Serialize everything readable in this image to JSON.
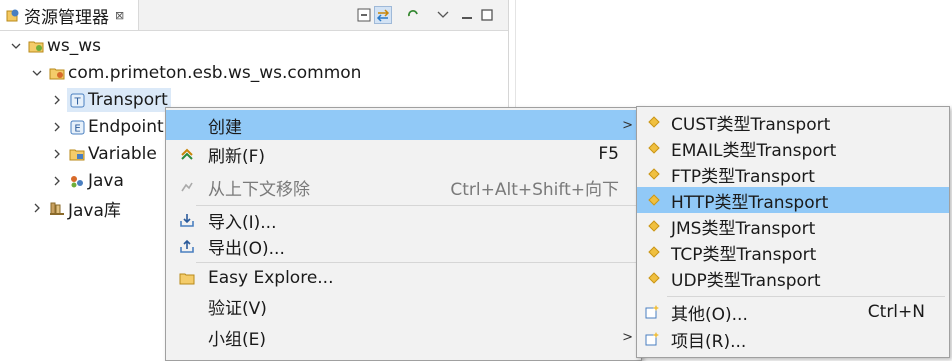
{
  "view": {
    "tab_title": "资源管理器",
    "tab_close": "⊠",
    "toolbar": [
      "collapse-all-icon",
      "link-with-editor-icon",
      "sync-icon",
      "view-menu-icon",
      "minimize-icon",
      "maximize-icon"
    ]
  },
  "tree": {
    "root": "ws_ws",
    "package": "com.primeton.esb.ws_ws.common",
    "children": [
      "Transport",
      "Endpoint",
      "Variable",
      "Java"
    ],
    "library": "Java库"
  },
  "context_menu": {
    "items": [
      {
        "label": "创建",
        "shortcut": "",
        "submenu": true
      },
      {
        "label": "刷新(F)",
        "shortcut": "F5"
      },
      {
        "label": "从上下文移除",
        "shortcut": "Ctrl+Alt+Shift+向下",
        "disabled": true
      },
      {
        "label": "导入(I)...",
        "shortcut": ""
      },
      {
        "label": "导出(O)...",
        "shortcut": ""
      },
      {
        "label": "Easy Explore...",
        "shortcut": ""
      },
      {
        "label": "验证(V)",
        "shortcut": ""
      },
      {
        "label": "小组(E)",
        "shortcut": "",
        "submenu": true
      }
    ]
  },
  "submenu": {
    "items": [
      "CUST类型Transport",
      "EMAIL类型Transport",
      "FTP类型Transport",
      "HTTP类型Transport",
      "JMS类型Transport",
      "TCP类型Transport",
      "UDP类型Transport"
    ],
    "other": {
      "label": "其他(O)...",
      "shortcut": "Ctrl+N"
    },
    "project": {
      "label": "项目(R)..."
    }
  },
  "colors": {
    "highlight": "#91c9f7",
    "menu_bg": "#f2f2f2"
  }
}
